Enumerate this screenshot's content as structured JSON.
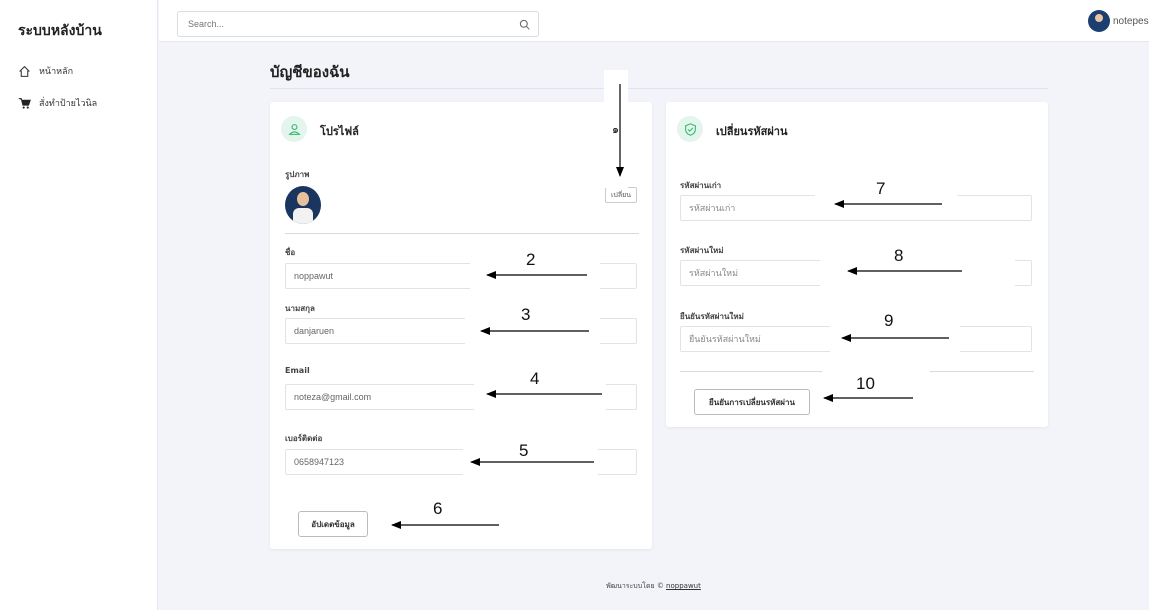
{
  "sidebar": {
    "brand": "ระบบหลังบ้าน",
    "items": [
      {
        "label": "หน้าหลัก",
        "icon": "home-icon"
      },
      {
        "label": "สั่งทำป้ายไวนิล",
        "icon": "cart-icon"
      }
    ]
  },
  "header": {
    "search_placeholder": "Search...",
    "username": "notepes"
  },
  "page": {
    "title": "บัญชีของฉัน"
  },
  "profile": {
    "title": "โปรไฟล์",
    "photo_label": "รูปภาพ",
    "change_photo": "เปลี่ยน",
    "first_name_label": "ชื่อ",
    "first_name": "noppawut",
    "last_name_label": "นามสกุล",
    "last_name": "danjaruen",
    "email_label": "Email",
    "email": "noteza@gmail.com",
    "phone_label": "เบอร์ติดต่อ",
    "phone": "0658947123",
    "update_button": "อัปเดตข้อมูล"
  },
  "password": {
    "title": "เปลี่ยนรหัสผ่าน",
    "old_label": "รหัสผ่านเก่า",
    "old_placeholder": "รหัสผ่านเก่า",
    "new_label": "รหัสผ่านใหม่",
    "new_placeholder": "รหัสผ่านใหม่",
    "confirm_label": "ยืนยันรหัสผ่านใหม่",
    "confirm_placeholder": "ยืนยันรหัสผ่านใหม่",
    "submit_button": "ยืนยันการเปลี่ยนรหัสผ่าน"
  },
  "annotations": {
    "n1": "๑",
    "n2": "2",
    "n3": "3",
    "n4": "4",
    "n5": "5",
    "n6": "6",
    "n7": "7",
    "n8": "8",
    "n9": "9",
    "n10": "10"
  },
  "footer": {
    "text": "พัฒนาระบบโดย © ",
    "author": "noppawut"
  },
  "colors": {
    "accent_green": "#2fb96b",
    "sidebar_bg": "#ffffff",
    "page_bg": "#f3f4f9"
  }
}
